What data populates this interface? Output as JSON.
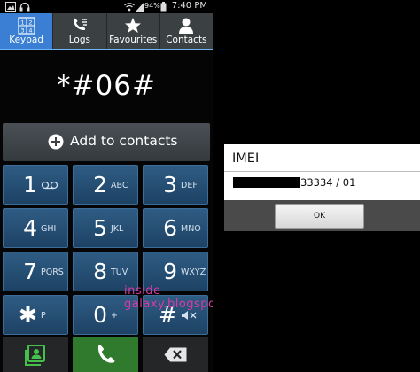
{
  "status_bar": {
    "time": "7:40 PM",
    "battery_percent": "94%",
    "icons": [
      "image-icon",
      "headphones-icon",
      "wifi-icon",
      "signal-icon",
      "battery-icon"
    ]
  },
  "tabs": [
    {
      "label": "Keypad",
      "icon": "keypad-grid-icon",
      "active": true
    },
    {
      "label": "Logs",
      "icon": "call-log-icon",
      "active": false
    },
    {
      "label": "Favourites",
      "icon": "star-icon",
      "active": false
    },
    {
      "label": "Contacts",
      "icon": "person-icon",
      "active": false
    }
  ],
  "dialer": {
    "number": "*#06#",
    "add_to_contacts_label": "Add to contacts",
    "keys": [
      {
        "digit": "1",
        "sub": "",
        "sub_icon": "voicemail-icon"
      },
      {
        "digit": "2",
        "sub": "ABC"
      },
      {
        "digit": "3",
        "sub": "DEF"
      },
      {
        "digit": "4",
        "sub": "GHI"
      },
      {
        "digit": "5",
        "sub": "JKL"
      },
      {
        "digit": "6",
        "sub": "MNO"
      },
      {
        "digit": "7",
        "sub": "PQRS"
      },
      {
        "digit": "8",
        "sub": "TUV"
      },
      {
        "digit": "9",
        "sub": "WXYZ"
      },
      {
        "digit": "✱",
        "sub": "P"
      },
      {
        "digit": "0",
        "sub": "+"
      },
      {
        "digit": "#",
        "sub": "",
        "sub_icon": "mute-icon"
      }
    ],
    "bottom_actions": [
      {
        "name": "contact-card-button",
        "icon": "contact-card-icon"
      },
      {
        "name": "call-button",
        "icon": "phone-icon"
      },
      {
        "name": "backspace-button",
        "icon": "backspace-icon"
      }
    ]
  },
  "watermark": "inside-galaxy.blogspot.com",
  "imei_dialog": {
    "title": "IMEI",
    "value_visible": "33334 / 01",
    "ok_label": "OK"
  },
  "colors": {
    "accent": "#3a7fd4",
    "key_blue": "#2a5a84",
    "call_green": "#2f7a2c",
    "watermark": "#d83aa6"
  }
}
